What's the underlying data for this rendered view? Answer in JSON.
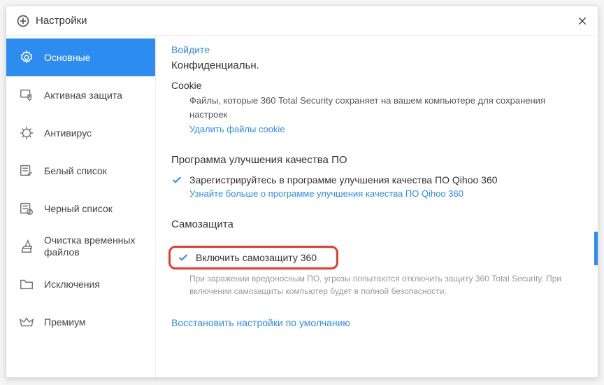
{
  "title": "Настройки",
  "sidebar": {
    "items": [
      {
        "label": "Основные"
      },
      {
        "label": "Активная защита"
      },
      {
        "label": "Антивирус"
      },
      {
        "label": "Белый список"
      },
      {
        "label": "Черный список"
      },
      {
        "label": "Очистка временных файлов"
      },
      {
        "label": "Исключения"
      },
      {
        "label": "Премиум"
      }
    ]
  },
  "content": {
    "login_link": "Войдите",
    "privacy_title": "Конфиденциальн.",
    "cookie_label": "Cookie",
    "cookie_desc": "Файлы, которые 360 Total Security сохраняет на вашем компьютере для сохранения настроек",
    "cookie_link": "Удалить файлы cookie",
    "improvement_title": "Программа улучшения качества ПО",
    "improvement_checkbox": "Зарегистрируйтесь в программе улучшения качества ПО Qihoo 360",
    "improvement_link": "Узнайте больше о программе улучшения качества ПО Qihoo 360",
    "selfprotect_title": "Самозащита",
    "selfprotect_checkbox": "Включить самозащиту 360",
    "selfprotect_desc": "При заражении вредоносным ПО, угрозы попытаются отключить защиту 360 Total Security. При включении самозащиты компьютер будет в полной безопасности.",
    "restore_link": "Восстановить настройки по умолчанию"
  }
}
